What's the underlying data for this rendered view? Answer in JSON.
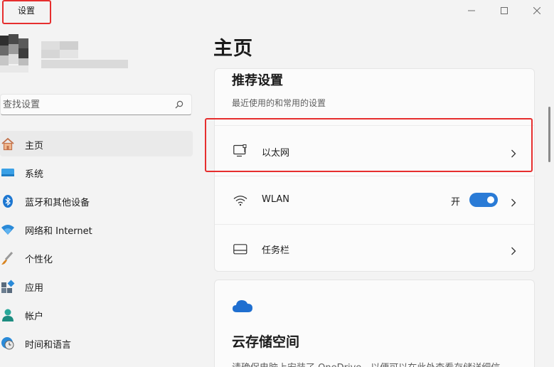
{
  "window": {
    "app_title": "设置",
    "controls": [
      "minimize-icon",
      "maximize-icon",
      "close-icon"
    ]
  },
  "search": {
    "placeholder": "查找设置",
    "icon": "search-icon"
  },
  "sidebar": {
    "items": [
      {
        "label": "主页",
        "icon": "home-icon",
        "active": true
      },
      {
        "label": "系统",
        "icon": "system-icon",
        "active": false
      },
      {
        "label": "蓝牙和其他设备",
        "icon": "bluetooth-icon",
        "active": false
      },
      {
        "label": "网络和 Internet",
        "icon": "wifi-icon",
        "active": false
      },
      {
        "label": "个性化",
        "icon": "personalization-icon",
        "active": false
      },
      {
        "label": "应用",
        "icon": "apps-icon",
        "active": false
      },
      {
        "label": "帐户",
        "icon": "account-icon",
        "active": false
      },
      {
        "label": "时间和语言",
        "icon": "time-language-icon",
        "active": false
      }
    ]
  },
  "main": {
    "title": "主页",
    "recommended": {
      "title": "推荐设置",
      "subtitle": "最近使用的和常用的设置",
      "rows": [
        {
          "label": "以太网",
          "icon": "ethernet-icon"
        },
        {
          "label": "WLAN",
          "icon": "wlan-icon",
          "toggle_text": "开",
          "toggle_on": true
        },
        {
          "label": "任务栏",
          "icon": "taskbar-icon"
        }
      ]
    },
    "cloud": {
      "title": "云存储空间",
      "description": "请确保电脑上安装了 OneDrive，以便可以在此处查看存储详细信",
      "icon": "cloud-icon"
    }
  },
  "colors": {
    "accent": "#2a7bd6",
    "annotation": "#e62e2e",
    "background": "#f3f3f3"
  }
}
